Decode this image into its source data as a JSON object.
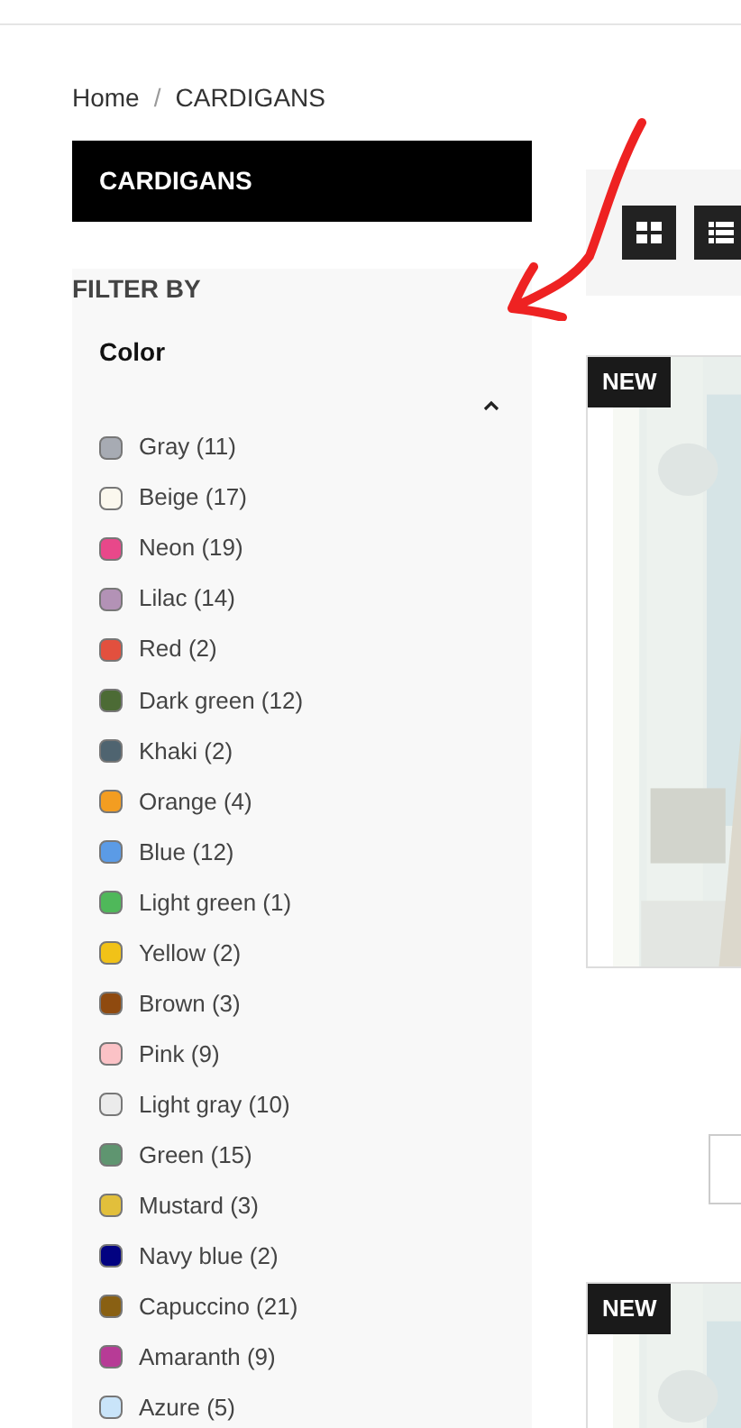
{
  "breadcrumb": [
    {
      "label": "Home"
    },
    {
      "label": "CARDIGANS"
    }
  ],
  "breadcrumb_separator": "/",
  "category_title": "CARDIGANS",
  "filter": {
    "heading": "FILTER BY",
    "group": "Color",
    "expanded": true,
    "colors": [
      {
        "label": "Gray (11)",
        "color": "#a7abb3"
      },
      {
        "label": "Beige (17)",
        "color": "#fbf8ee"
      },
      {
        "label": "Neon (19)",
        "color": "#e8488a"
      },
      {
        "label": "Lilac (14)",
        "color": "#b392b6"
      },
      {
        "label": "Red (2)",
        "color": "#e2503e"
      },
      {
        "label": "Dark green (12)",
        "color": "#4c6b35"
      },
      {
        "label": "Khaki (2)",
        "color": "#4f6470"
      },
      {
        "label": "Orange (4)",
        "color": "#f39d21"
      },
      {
        "label": "Blue (12)",
        "color": "#5b9be6"
      },
      {
        "label": "Light green (1)",
        "color": "#4fb85a"
      },
      {
        "label": "Yellow (2)",
        "color": "#f1c218"
      },
      {
        "label": "Brown (3)",
        "color": "#8f4a0f"
      },
      {
        "label": "Pink (9)",
        "color": "#fbc2c6"
      },
      {
        "label": "Light gray (10)",
        "color": "#ebebeb"
      },
      {
        "label": "Green (15)",
        "color": "#5f9570"
      },
      {
        "label": "Mustard (3)",
        "color": "#e2bf3b"
      },
      {
        "label": "Navy blue (2)",
        "color": "#020281"
      },
      {
        "label": "Capuccino (21)",
        "color": "#896013"
      },
      {
        "label": "Amaranth (9)",
        "color": "#b73b96"
      },
      {
        "label": "Azure (5)",
        "color": "#c9e4f9"
      }
    ]
  },
  "view_modes": [
    {
      "kind": "grid",
      "selected": true
    },
    {
      "kind": "list",
      "selected": true
    }
  ],
  "products": [
    {
      "badge": "NEW",
      "kind": "picture"
    },
    {
      "badge": "NEW",
      "kind": "picture"
    }
  ]
}
